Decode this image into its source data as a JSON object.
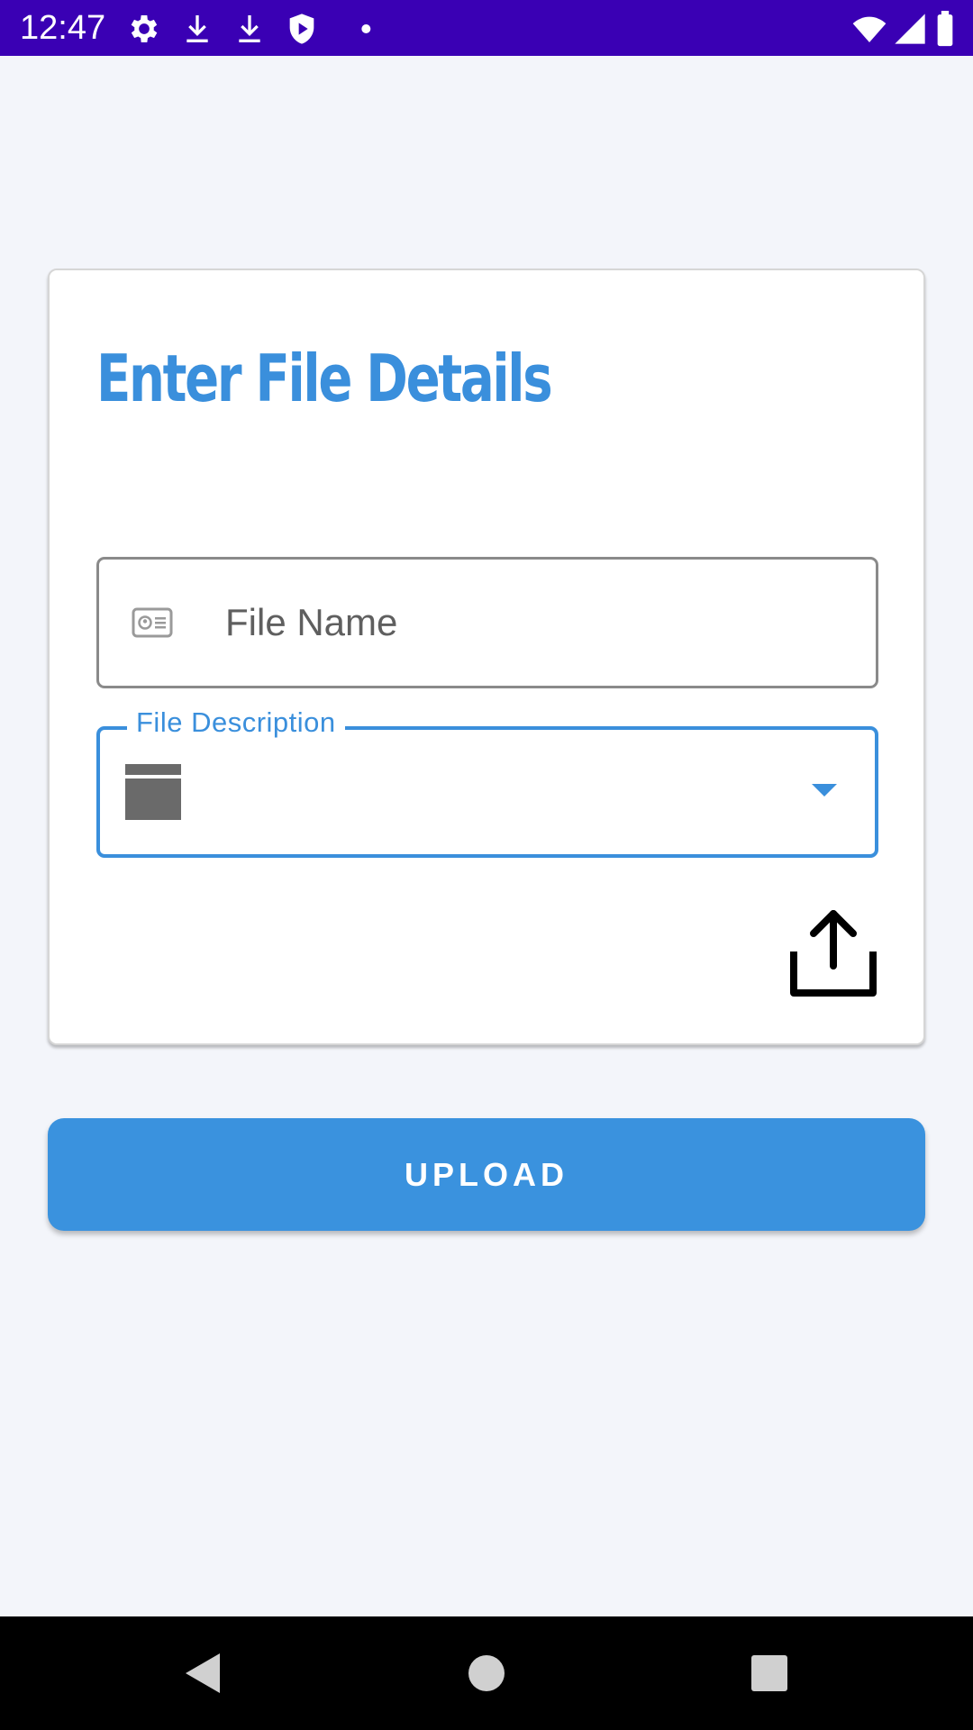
{
  "status_bar": {
    "time": "12:47",
    "left_icons": [
      "gear-icon",
      "download-icon",
      "download-icon",
      "shield-play-icon",
      "dot-icon"
    ],
    "right_icons": [
      "wifi-icon",
      "signal-icon",
      "battery-icon"
    ],
    "background": "#3a00b4"
  },
  "card": {
    "title": "Enter File Details",
    "file_name": {
      "placeholder": "File Name",
      "value": "",
      "icon": "id-card-icon"
    },
    "file_description": {
      "label": "File Description",
      "selected_value": "",
      "icon": "window-icon",
      "arrow_icon": "dropdown-arrow-icon"
    },
    "action_icon": "share-icon"
  },
  "upload_button": {
    "label": "UPLOAD"
  },
  "nav_bar": {
    "buttons": [
      "back-icon",
      "home-icon",
      "recents-icon"
    ]
  },
  "colors": {
    "accent": "#3a8fdc",
    "background": "#f3f5fa",
    "card": "#ffffff"
  }
}
